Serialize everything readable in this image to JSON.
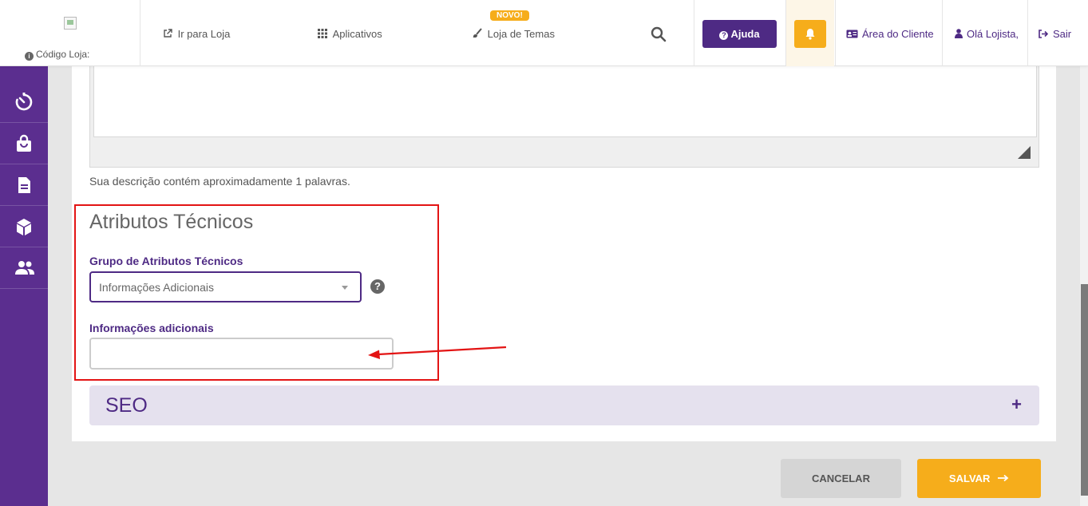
{
  "header": {
    "store_code_label": "Código Loja:",
    "go_to_store": "Ir para Loja",
    "apps": "Aplicativos",
    "theme_store": "Loja de Temas",
    "new_badge": "NOVO!",
    "help": "Ajuda",
    "client_area": "Área do Cliente",
    "greeting": "Olá Lojista,",
    "logout": "Sair"
  },
  "sidebar": {
    "icons": [
      "timer-icon",
      "shopping-bag-icon",
      "document-icon",
      "box-icon",
      "users-icon"
    ]
  },
  "main": {
    "description_count": "Sua descrição contém aproximadamente 1 palavras.",
    "tech_section_title": "Atributos Técnicos",
    "group_label": "Grupo de Atributos Técnicos",
    "group_value": "Informações Adicionais",
    "additional_label": "Informações adicionais",
    "additional_value": "",
    "seo_title": "SEO",
    "seo_toggle": "+"
  },
  "footer": {
    "cancel": "CANCELAR",
    "save": "SALVAR"
  },
  "colors": {
    "brand_purple": "#4e2a84",
    "sidebar_purple": "#5b2e8f",
    "accent_yellow": "#f6ad1b",
    "highlight_red": "#e31414"
  }
}
